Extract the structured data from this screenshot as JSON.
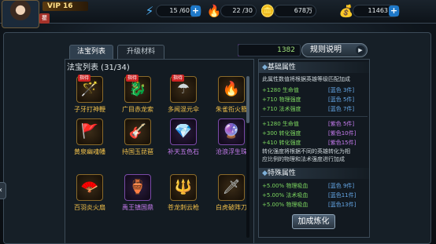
{
  "player": {
    "vip": "VIP 16",
    "badge": "瞿"
  },
  "resources": [
    {
      "icon": "stamina-icon",
      "value": "15 /60"
    },
    {
      "icon": "energy-icon",
      "value": "22 /30"
    },
    {
      "icon": "coin-icon",
      "value": "678万"
    },
    {
      "icon": "gold-ingot-icon",
      "value": "11463"
    }
  ],
  "tabs": [
    {
      "label": "法宝列表"
    },
    {
      "label": "升级材料"
    }
  ],
  "material": {
    "count": "1382"
  },
  "rules_button": "规则说明",
  "list_title": "法宝列表 (31/34)",
  "hot_tag": "指待",
  "items": [
    {
      "name": "子牙打神鞭",
      "rarity": "gold",
      "hot": true,
      "glyph": "🪄"
    },
    {
      "name": "广目赤龙索",
      "rarity": "gold",
      "hot": true,
      "glyph": "🐉"
    },
    {
      "name": "多闻混元伞",
      "rarity": "gold",
      "hot": true,
      "glyph": "☂"
    },
    {
      "name": "朱雀衔火簪",
      "rarity": "gold",
      "hot": false,
      "glyph": "🔥"
    },
    {
      "name": "黄泉幽魂幡",
      "rarity": "gold",
      "hot": false,
      "glyph": "🚩"
    },
    {
      "name": "持国玉琵琶",
      "rarity": "gold",
      "hot": false,
      "glyph": "🎸"
    },
    {
      "name": "补天五色石",
      "rarity": "purple",
      "hot": false,
      "glyph": "💎"
    },
    {
      "name": "沧浪浮生珠",
      "rarity": "purple",
      "hot": false,
      "glyph": "🔮"
    },
    {
      "name": "百羽炎火扇",
      "rarity": "gold",
      "hot": false,
      "glyph": "🪭"
    },
    {
      "name": "禹王镇国鼎",
      "rarity": "purple",
      "hot": false,
      "glyph": "🏺"
    },
    {
      "name": "苍龙刺云枪",
      "rarity": "gold",
      "hot": false,
      "glyph": "🔱"
    },
    {
      "name": "白虎破阵刀",
      "rarity": "gold",
      "hot": false,
      "glyph": "🗡"
    }
  ],
  "attributes": {
    "base_title": "基础属性",
    "base_note": "此属性数值将根据英雄等级匹配加成",
    "base_lines": [
      {
        "value": "+1280 生命值",
        "tag": "[蓝色 3件]",
        "color": "blue"
      },
      {
        "value": "+710 物理强度",
        "tag": "[蓝色 5件]",
        "color": "blue"
      },
      {
        "value": "+710 法术强度",
        "tag": "[蓝色 7件]",
        "color": "blue"
      }
    ],
    "purple_lines": [
      {
        "value": "+1280 生命值",
        "tag": "[紫色 5件]",
        "color": "purple"
      },
      {
        "value": "+300 转化强度",
        "tag": "[紫色10件]",
        "color": "purple"
      },
      {
        "value": "+410 转化强度",
        "tag": "[紫色15件]",
        "color": "purple"
      }
    ],
    "convert_note_1": "转化强度将根据不同的英雄转化为相",
    "convert_note_2": "应比例的物理和法术强度进行加成",
    "special_title": "特殊属性",
    "special_lines": [
      {
        "value": "+5.00% 物理吸血",
        "tag": "[蓝色 9件]",
        "color": "blue"
      },
      {
        "value": "+5.00% 法术吸血",
        "tag": "[蓝色11件]",
        "color": "blue"
      },
      {
        "value": "+5.00% 物理吸血",
        "tag": "[蓝色13件]",
        "color": "blue"
      }
    ]
  },
  "synth_button": "加成炼化"
}
